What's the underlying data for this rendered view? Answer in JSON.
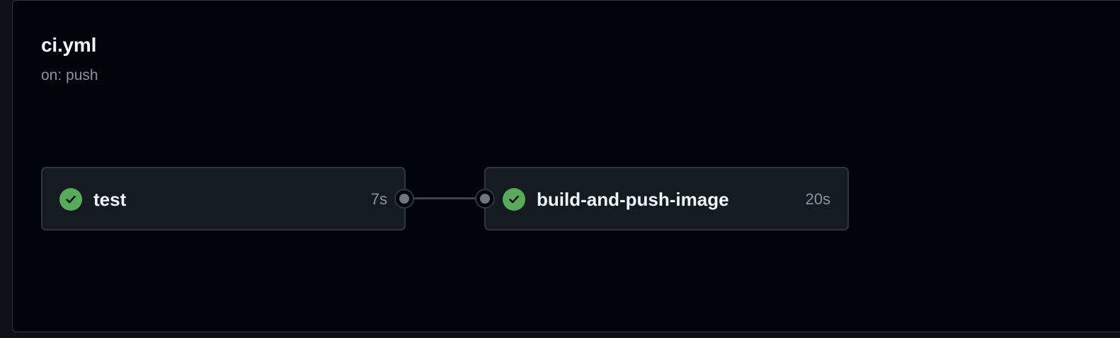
{
  "workflow": {
    "title": "ci.yml",
    "trigger": "on: push"
  },
  "jobs": [
    {
      "name": "test",
      "duration": "7s",
      "status": "success",
      "status_icon": "check-circle-icon"
    },
    {
      "name": "build-and-push-image",
      "duration": "20s",
      "status": "success",
      "status_icon": "check-circle-icon"
    }
  ],
  "colors": {
    "success": "#57ab5a",
    "background": "#010409",
    "card": "#161b22",
    "border": "#30363d",
    "text_primary": "#f0f6fc",
    "text_muted": "#8b949e"
  }
}
